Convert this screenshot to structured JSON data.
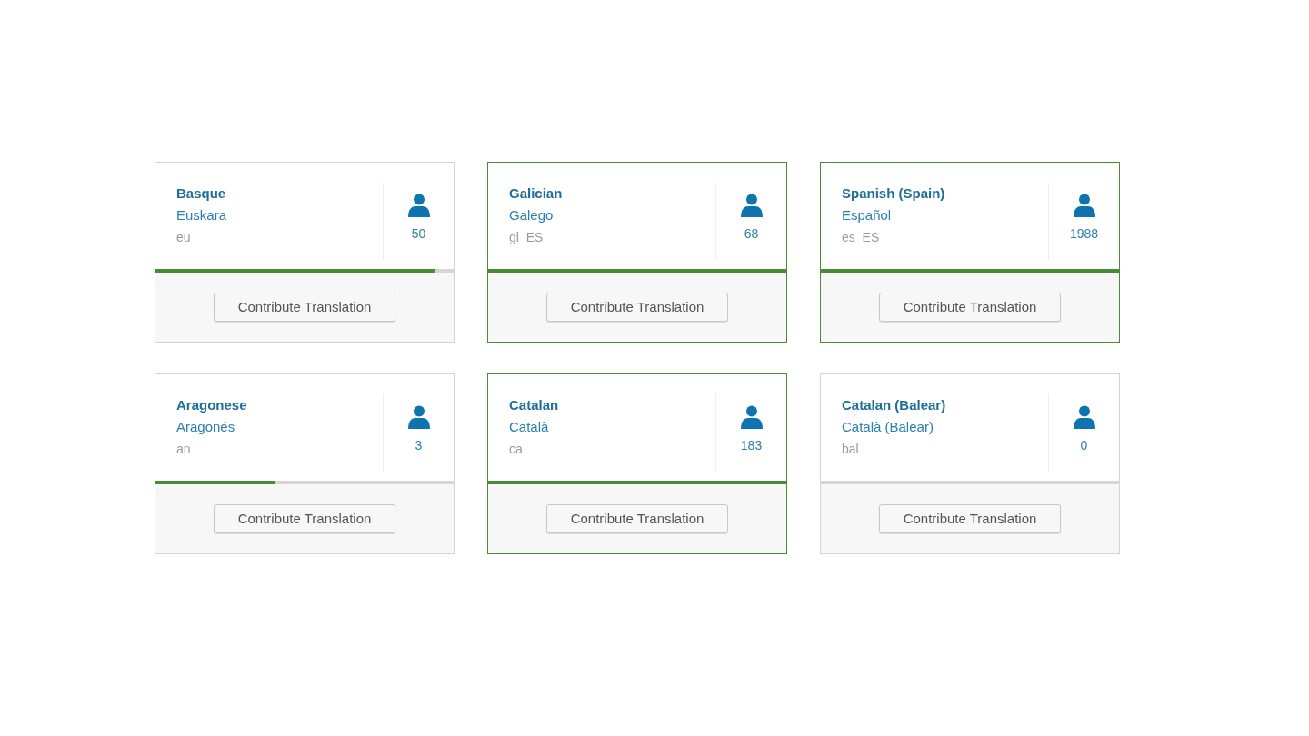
{
  "languages": [
    {
      "name": "Basque",
      "native": "Euskara",
      "code": "eu",
      "contributors": "50",
      "level": 0.94,
      "button": "Contribute Translation"
    },
    {
      "name": "Galician",
      "native": "Galego",
      "code": "gl_ES",
      "contributors": "68",
      "level": 1,
      "button": "Contribute Translation"
    },
    {
      "name": "Spanish (Spain)",
      "native": "Español",
      "code": "es_ES",
      "contributors": "1988",
      "level": 1,
      "button": "Contribute Translation"
    },
    {
      "name": "Aragonese",
      "native": "Aragonés",
      "code": "an",
      "contributors": "3",
      "level": 0.4,
      "button": "Contribute Translation"
    },
    {
      "name": "Catalan",
      "native": "Català",
      "code": "ca",
      "contributors": "183",
      "level": 1,
      "button": "Contribute Translation"
    },
    {
      "name": "Catalan (Balear)",
      "native": "Català (Balear)",
      "code": "bal",
      "contributors": "0",
      "level": 0,
      "button": "Contribute Translation"
    }
  ]
}
